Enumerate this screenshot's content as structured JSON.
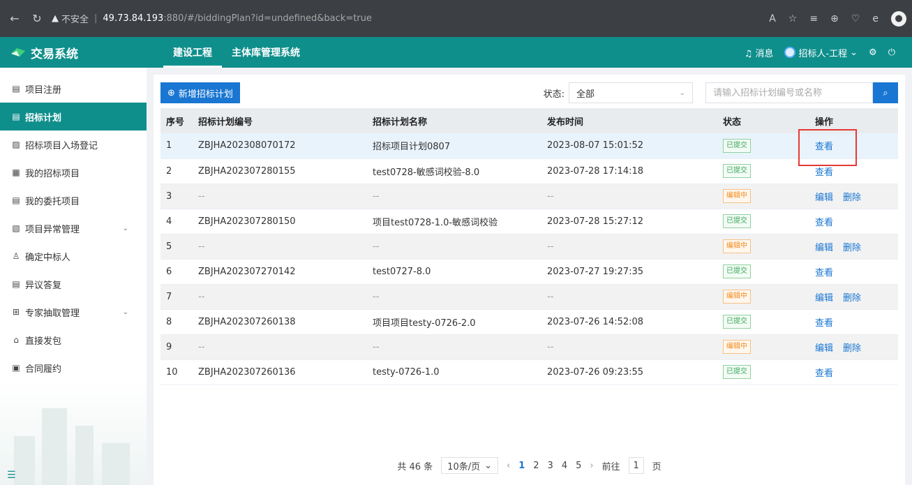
{
  "browser": {
    "warning": "不安全",
    "host": "49.73.84.193",
    "path": ":880/#/biddingPlan?id=undefined&back=true",
    "right_icons": [
      "read-aloud-icon",
      "favorite-star-icon",
      "favorites-list-icon",
      "extensions-icon",
      "health-icon",
      "edge-icon",
      "profile-icon"
    ]
  },
  "app": {
    "logo_text": "交易系统",
    "tabs": [
      {
        "label": "建设工程",
        "active": true
      },
      {
        "label": "主体库管理系统",
        "active": false
      }
    ],
    "messages_label": "消息",
    "user_label": "招标人-工程"
  },
  "sidebar": {
    "items": [
      {
        "label": "项目注册",
        "icon": "doc-icon"
      },
      {
        "label": "招标计划",
        "icon": "doc-icon",
        "active": true
      },
      {
        "label": "招标项目入场登记",
        "icon": "register-icon"
      },
      {
        "label": "我的招标项目",
        "icon": "project-icon"
      },
      {
        "label": "我的委托项目",
        "icon": "doc-icon"
      },
      {
        "label": "项目异常管理",
        "icon": "alert-doc-icon",
        "expandable": true
      },
      {
        "label": "确定中标人",
        "icon": "user-icon"
      },
      {
        "label": "异议答复",
        "icon": "doc-icon"
      },
      {
        "label": "专家抽取管理",
        "icon": "expert-icon",
        "expandable": true
      },
      {
        "label": "直接发包",
        "icon": "package-icon"
      },
      {
        "label": "合同履约",
        "icon": "contract-icon"
      }
    ]
  },
  "toolbar": {
    "add_label": "新增招标计划",
    "status_label": "状态:",
    "status_value": "全部",
    "search_placeholder": "请输入招标计划编号或名称"
  },
  "table": {
    "headers": [
      "序号",
      "招标计划编号",
      "招标计划名称",
      "发布时间",
      "状态",
      "操作"
    ],
    "rows": [
      {
        "no": "1",
        "code": "ZBJHA202308070172",
        "name": "招标项目计划0807",
        "time": "2023-08-07 15:01:52",
        "status": "已提交",
        "ops": [
          "查看"
        ]
      },
      {
        "no": "2",
        "code": "ZBJHA202307280155",
        "name": "test0728-敏感词校验-8.0",
        "time": "2023-07-28 17:14:18",
        "status": "已提交",
        "ops": [
          "查看"
        ]
      },
      {
        "no": "3",
        "code": "--",
        "name": "--",
        "time": "--",
        "status": "编辑中",
        "ops": [
          "编辑",
          "删除"
        ]
      },
      {
        "no": "4",
        "code": "ZBJHA202307280150",
        "name": "项目test0728-1.0-敏感词校验",
        "time": "2023-07-28 15:27:12",
        "status": "已提交",
        "ops": [
          "查看"
        ]
      },
      {
        "no": "5",
        "code": "--",
        "name": "--",
        "time": "--",
        "status": "编辑中",
        "ops": [
          "编辑",
          "删除"
        ]
      },
      {
        "no": "6",
        "code": "ZBJHA202307270142",
        "name": "test0727-8.0",
        "time": "2023-07-27 19:27:35",
        "status": "已提交",
        "ops": [
          "查看"
        ]
      },
      {
        "no": "7",
        "code": "--",
        "name": "--",
        "time": "--",
        "status": "编辑中",
        "ops": [
          "编辑",
          "删除"
        ]
      },
      {
        "no": "8",
        "code": "ZBJHA202307260138",
        "name": "项目项目testy-0726-2.0",
        "time": "2023-07-26 14:52:08",
        "status": "已提交",
        "ops": [
          "查看"
        ]
      },
      {
        "no": "9",
        "code": "--",
        "name": "--",
        "time": "--",
        "status": "编辑中",
        "ops": [
          "编辑",
          "删除"
        ]
      },
      {
        "no": "10",
        "code": "ZBJHA202307260136",
        "name": "testy-0726-1.0",
        "time": "2023-07-26 09:23:55",
        "status": "已提交",
        "ops": [
          "查看"
        ]
      }
    ]
  },
  "pager": {
    "total": "共 46 条",
    "size": "10条/页",
    "pages": [
      "1",
      "2",
      "3",
      "4",
      "5"
    ],
    "current": "1",
    "goto_prefix": "前往",
    "goto_value": "1",
    "goto_suffix": "页"
  }
}
